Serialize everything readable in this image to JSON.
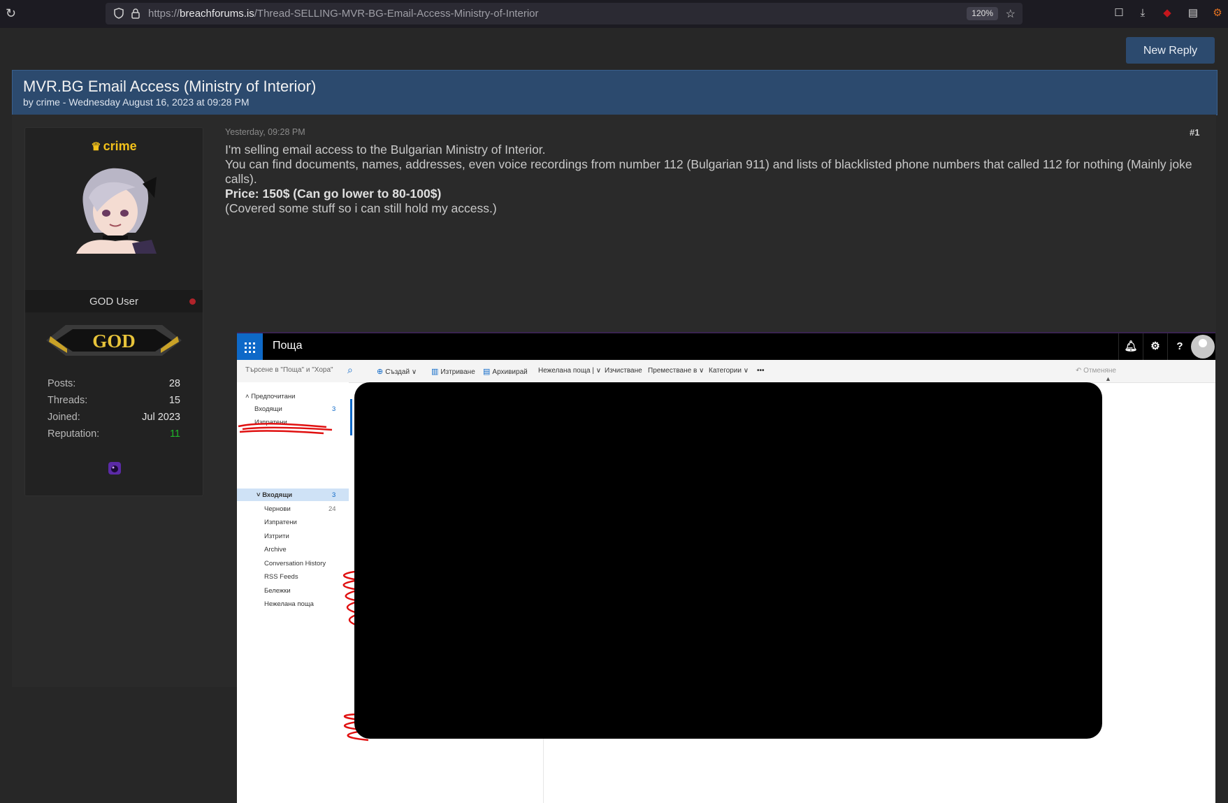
{
  "browser": {
    "url_prefix": "https://",
    "url_domain": "breachforums.is",
    "url_path": "/Thread-SELLING-MVR-BG-Email-Access-Ministry-of-Interior",
    "zoom": "120%"
  },
  "page": {
    "new_reply_label": "New Reply",
    "thread_title": "MVR.BG Email Access (Ministry of Interior)",
    "thread_byline": "by crime - Wednesday August 16, 2023 at 09:28 PM"
  },
  "user": {
    "name": "crime",
    "rank_title": "GOD User",
    "badge_text": "GOD",
    "stats": [
      {
        "label": "Posts:",
        "value": "28"
      },
      {
        "label": "Threads:",
        "value": "15"
      },
      {
        "label": "Joined:",
        "value": "Jul 2023"
      },
      {
        "label": "Reputation:",
        "value": "11"
      }
    ]
  },
  "post": {
    "date": "Yesterday, 09:28 PM",
    "number": "#1",
    "line1": "I'm selling email access to the Bulgarian Ministry of Interior.",
    "line2": "You can find documents, names, addresses, even voice recordings from number 112 (Bulgarian 911) and lists of blacklisted phone numbers that called 112 for nothing (Mainly joke calls).",
    "price": "Price: 150$ (Can go lower to 80-100$)",
    "line4": "(Covered some stuff so i can still hold my access.)"
  },
  "owa": {
    "app_title": "Поща",
    "search_placeholder": "Търсене в \"Поща\" и \"Хора\"",
    "commands": {
      "create": "Създай",
      "delete": "Изтриване",
      "archive": "Архивирай",
      "junk": "Нежелана поща",
      "sweep": "Изчистване",
      "move": "Преместване в",
      "categories": "Категории",
      "more": "•••",
      "undo": "Отменяне"
    },
    "favorites_header": "Предпочитани",
    "favorites": [
      {
        "label": "Входящи",
        "count": "3"
      },
      {
        "label": "Изпратени",
        "count": ""
      }
    ],
    "folders": [
      {
        "label": "Входящи",
        "count": "3"
      },
      {
        "label": "Чернови",
        "count": "24"
      },
      {
        "label": "Изпратени",
        "count": ""
      },
      {
        "label": "Изтрити",
        "count": ""
      },
      {
        "label": "Archive",
        "count": ""
      },
      {
        "label": "Conversation History",
        "count": ""
      },
      {
        "label": "RSS Feeds",
        "count": ""
      },
      {
        "label": "Бележки",
        "count": ""
      },
      {
        "label": "Нежелана поща",
        "count": ""
      }
    ]
  },
  "colors": {
    "header_blue": "#2c4a6e",
    "username_gold": "#f2c11a",
    "reputation_green": "#1fb62a",
    "owa_blue": "#0e69c8",
    "redaction": "#000000",
    "scribble_red": "#e01010"
  }
}
